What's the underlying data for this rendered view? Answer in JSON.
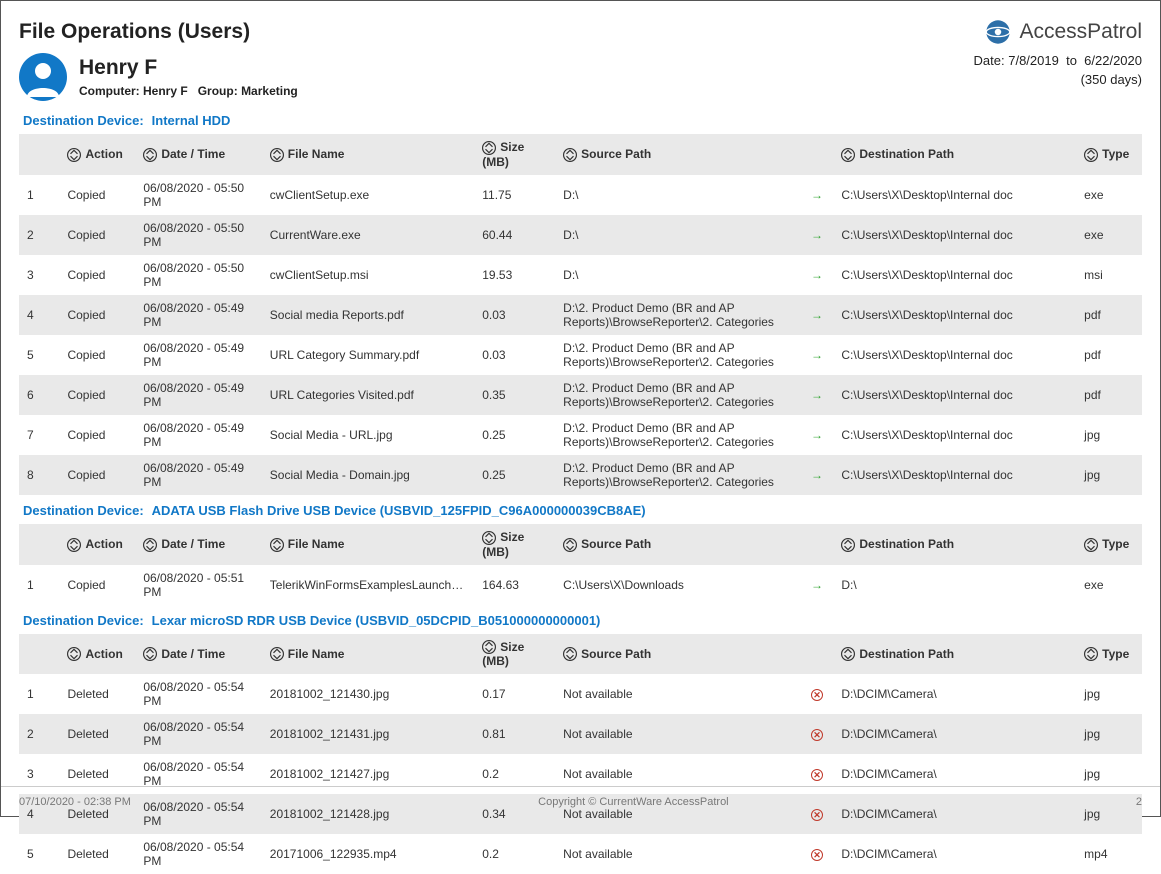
{
  "title": "File Operations (Users)",
  "brand": "AccessPatrol",
  "user": {
    "name": "Henry F",
    "computer_label": "Computer:",
    "computer": "Henry F",
    "group_label": "Group:",
    "group": "Marketing"
  },
  "range": {
    "prefix": "Date:",
    "from": "7/8/2019",
    "to_word": "to",
    "to": "6/22/2020",
    "days": "(350 days)"
  },
  "device_label": "Destination Device:",
  "columns": {
    "action": "Action",
    "datetime": "Date / Time",
    "filename": "File Name",
    "size": "Size (MB)",
    "source": "Source Path",
    "dest": "Destination Path",
    "type": "Type"
  },
  "sections": [
    {
      "device": "Internal HDD",
      "rows": [
        {
          "n": "1",
          "action": "Copied",
          "dt": "06/08/2020 - 05:50 PM",
          "file": "cwClientSetup.exe",
          "size": "11.75",
          "src": "D:\\",
          "op": "copy",
          "dest": "C:\\Users\\X\\Desktop\\Internal doc",
          "type": "exe"
        },
        {
          "n": "2",
          "action": "Copied",
          "dt": "06/08/2020 - 05:50 PM",
          "file": "CurrentWare.exe",
          "size": "60.44",
          "src": "D:\\",
          "op": "copy",
          "dest": "C:\\Users\\X\\Desktop\\Internal doc",
          "type": "exe"
        },
        {
          "n": "3",
          "action": "Copied",
          "dt": "06/08/2020 - 05:50 PM",
          "file": "cwClientSetup.msi",
          "size": "19.53",
          "src": "D:\\",
          "op": "copy",
          "dest": "C:\\Users\\X\\Desktop\\Internal doc",
          "type": "msi"
        },
        {
          "n": "4",
          "action": "Copied",
          "dt": "06/08/2020 - 05:49 PM",
          "file": "Social media Reports.pdf",
          "size": "0.03",
          "src": "D:\\2. Product Demo (BR and AP Reports)\\BrowseReporter\\2. Categories",
          "op": "copy",
          "dest": "C:\\Users\\X\\Desktop\\Internal doc",
          "type": "pdf"
        },
        {
          "n": "5",
          "action": "Copied",
          "dt": "06/08/2020 - 05:49 PM",
          "file": "URL Category Summary.pdf",
          "size": "0.03",
          "src": "D:\\2. Product Demo (BR and AP Reports)\\BrowseReporter\\2. Categories",
          "op": "copy",
          "dest": "C:\\Users\\X\\Desktop\\Internal doc",
          "type": "pdf"
        },
        {
          "n": "6",
          "action": "Copied",
          "dt": "06/08/2020 - 05:49 PM",
          "file": "URL Categories Visited.pdf",
          "size": "0.35",
          "src": "D:\\2. Product Demo (BR and AP Reports)\\BrowseReporter\\2. Categories",
          "op": "copy",
          "dest": "C:\\Users\\X\\Desktop\\Internal doc",
          "type": "pdf"
        },
        {
          "n": "7",
          "action": "Copied",
          "dt": "06/08/2020 - 05:49 PM",
          "file": "Social Media - URL.jpg",
          "size": "0.25",
          "src": "D:\\2. Product Demo (BR and AP Reports)\\BrowseReporter\\2. Categories",
          "op": "copy",
          "dest": "C:\\Users\\X\\Desktop\\Internal doc",
          "type": "jpg"
        },
        {
          "n": "8",
          "action": "Copied",
          "dt": "06/08/2020 - 05:49 PM",
          "file": "Social Media - Domain.jpg",
          "size": "0.25",
          "src": "D:\\2. Product Demo (BR and AP Reports)\\BrowseReporter\\2. Categories",
          "op": "copy",
          "dest": "C:\\Users\\X\\Desktop\\Internal doc",
          "type": "jpg"
        }
      ]
    },
    {
      "device": "ADATA USB Flash Drive USB Device (USBVID_125FPID_C96A000000039CB8AE)",
      "rows": [
        {
          "n": "1",
          "action": "Copied",
          "dt": "06/08/2020 - 05:51 PM",
          "file": "TelerikWinFormsExamplesLauncher.exe",
          "size": "164.63",
          "src": "C:\\Users\\X\\Downloads",
          "op": "copy",
          "dest": "D:\\",
          "type": "exe"
        }
      ]
    },
    {
      "device": "Lexar microSD RDR USB Device (USBVID_05DCPID_B051000000000001)",
      "rows": [
        {
          "n": "1",
          "action": "Deleted",
          "dt": "06/08/2020 - 05:54 PM",
          "file": "20181002_121430.jpg",
          "size": "0.17",
          "src": "Not available",
          "op": "del",
          "dest": "D:\\DCIM\\Camera\\",
          "type": "jpg"
        },
        {
          "n": "2",
          "action": "Deleted",
          "dt": "06/08/2020 - 05:54 PM",
          "file": "20181002_121431.jpg",
          "size": "0.81",
          "src": "Not available",
          "op": "del",
          "dest": "D:\\DCIM\\Camera\\",
          "type": "jpg"
        },
        {
          "n": "3",
          "action": "Deleted",
          "dt": "06/08/2020 - 05:54 PM",
          "file": "20181002_121427.jpg",
          "size": "0.2",
          "src": "Not available",
          "op": "del",
          "dest": "D:\\DCIM\\Camera\\",
          "type": "jpg"
        },
        {
          "n": "4",
          "action": "Deleted",
          "dt": "06/08/2020 - 05:54 PM",
          "file": "20181002_121428.jpg",
          "size": "0.34",
          "src": "Not available",
          "op": "del",
          "dest": "D:\\DCIM\\Camera\\",
          "type": "jpg"
        },
        {
          "n": "5",
          "action": "Deleted",
          "dt": "06/08/2020 - 05:54 PM",
          "file": "20171006_122935.mp4",
          "size": "0.2",
          "src": "Not available",
          "op": "del",
          "dest": "D:\\DCIM\\Camera\\",
          "type": "mp4"
        }
      ]
    }
  ],
  "footer": {
    "left": "07/10/2020 - 02:38 PM",
    "center": "Copyright © CurrentWare AccessPatrol",
    "right": "2"
  }
}
